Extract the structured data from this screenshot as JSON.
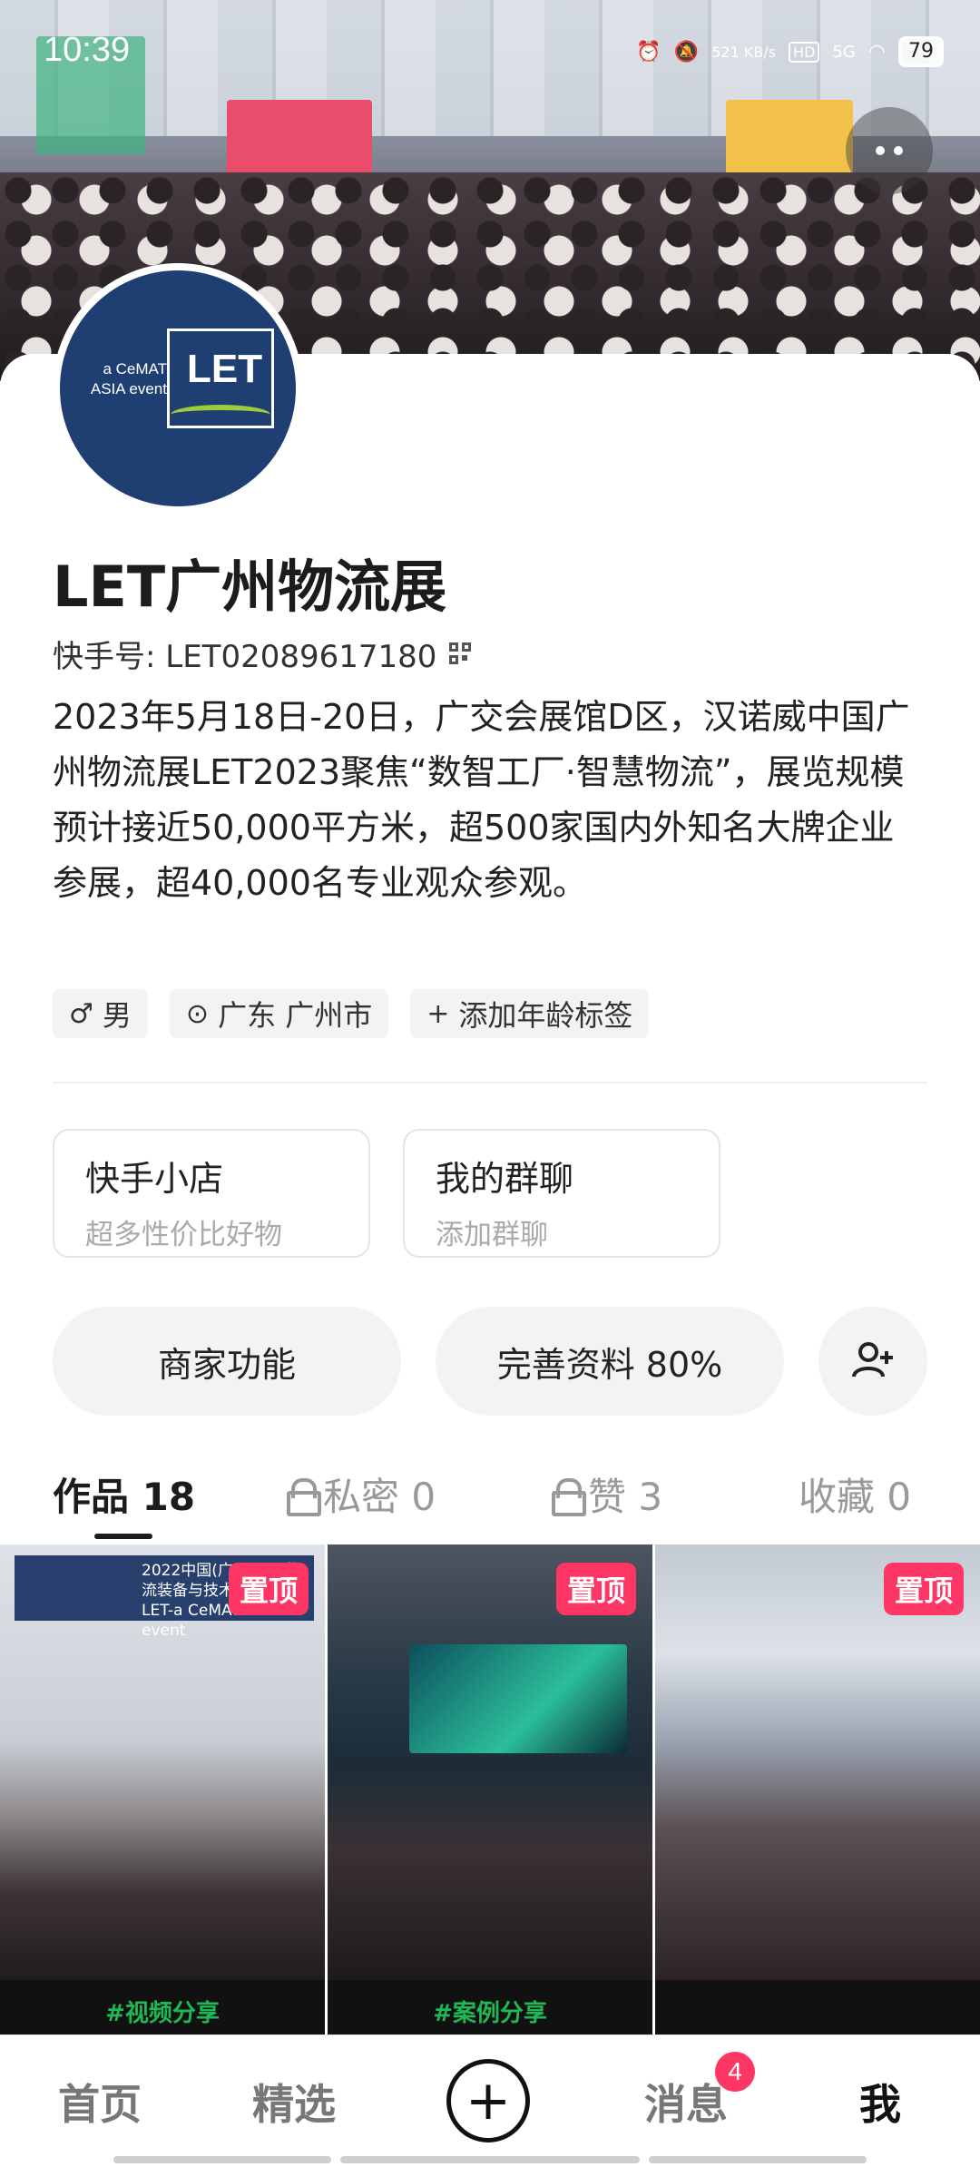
{
  "status_bar": {
    "time": "10:39",
    "net_speed": "521 KB/s",
    "hd": "HD",
    "network": "5G",
    "battery": "79"
  },
  "profile": {
    "name": "LET广州物流展",
    "kuaishou_id": "快手号: LET02089617180",
    "avatar_side_text": "a CeMAT ASIA event",
    "avatar_logo_text": "LET",
    "bio": "2023年5月18日-20日，广交会展馆D区，汉诺威中国广州物流展LET2023聚焦“数智工厂·智慧物流”，展览规模预计接近50,000平方米，超500家国内外知名大牌企业参展，超40,000名专业观众参观。",
    "tags": [
      {
        "icon": "male-icon",
        "label": "男"
      },
      {
        "icon": "location-icon",
        "label": "广东 广州市"
      },
      {
        "icon": "plus-icon",
        "label": "添加年龄标签"
      }
    ]
  },
  "shortcuts": [
    {
      "title": "快手小店",
      "subtitle": "超多性价比好物"
    },
    {
      "title": "我的群聊",
      "subtitle": "添加群聊"
    }
  ],
  "actions": {
    "merchant": "商家功能",
    "complete_profile": "完善资料 80%"
  },
  "tabs": [
    {
      "label": "作品 18",
      "locked": false,
      "active": true
    },
    {
      "label": "私密 0",
      "locked": true,
      "active": false
    },
    {
      "label": "赞 3",
      "locked": true,
      "active": false
    },
    {
      "label": "收藏 0",
      "locked": false,
      "active": false
    }
  ],
  "grid": [
    {
      "pin": "置顶",
      "banner": "2022中国(广州)国际物流装备与技术展览会 LET-a CeMAT ASIA event",
      "footer": "#视频分享"
    },
    {
      "pin": "置顶",
      "footer": "#案例分享"
    },
    {
      "pin": "置顶",
      "footer": ""
    }
  ],
  "bottom_nav": {
    "home": "首页",
    "featured": "精选",
    "add": "+",
    "messages": "消息",
    "messages_badge": "4",
    "me": "我"
  },
  "colors": {
    "accent_red": "#fe3666",
    "avatar_blue": "#1f3f73",
    "logo_green": "#9ccb3b"
  }
}
